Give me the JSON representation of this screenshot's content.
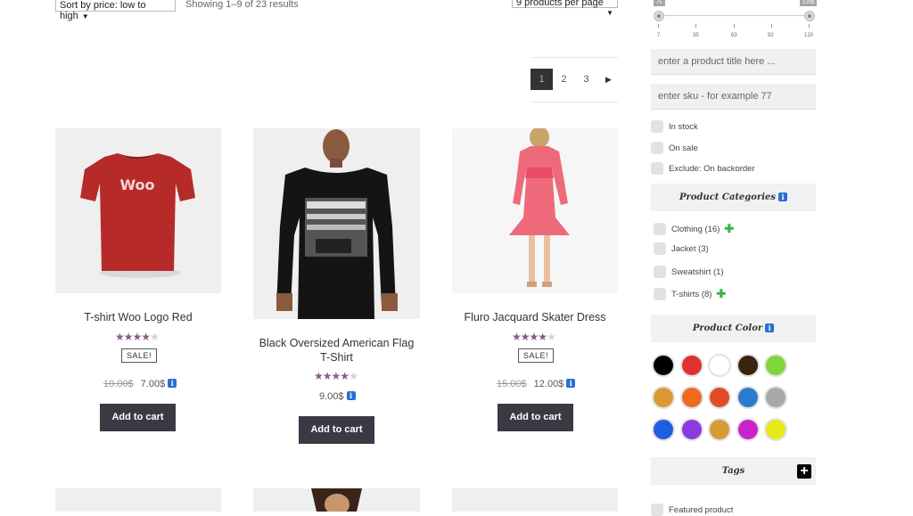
{
  "toolbar": {
    "sort_label": "Sort by price: low to high",
    "result_count": "Showing 1–9 of 23 results",
    "per_page_label": "9 products per page"
  },
  "pagination": {
    "pages": [
      "1",
      "2",
      "3"
    ],
    "current": "1",
    "next_icon": "triangle-right-icon"
  },
  "products": [
    {
      "title": "T-shirt Woo Logo Red",
      "rating": 4,
      "sale_badge": "SALE!",
      "old_price": "10.00$",
      "price": "7.00$",
      "button": "Add to cart",
      "image_text": "Woo"
    },
    {
      "title": "Black Oversized American Flag T-Shirt",
      "rating": 4,
      "price": "9.00$",
      "button": "Add to cart"
    },
    {
      "title": "Fluro Jacquard Skater Dress",
      "rating": 4,
      "sale_badge": "SALE!",
      "old_price": "15.00$",
      "price": "12.00$",
      "button": "Add to cart"
    }
  ],
  "sidebar": {
    "price_slider": {
      "min_value": "75",
      "max_value": "120$",
      "tick_labels": [
        "7",
        "35",
        "63",
        "92",
        "120"
      ]
    },
    "title_search_placeholder": "enter a product title here ...",
    "sku_search_placeholder": "enter sku - for example 77",
    "stock_filters": [
      "In stock",
      "On sale",
      "Exclude: On backorder"
    ],
    "categories_heading": "Product Categories",
    "categories": [
      {
        "label": "Clothing (16)",
        "expandable": true
      },
      {
        "label": "Jacket (3)",
        "expandable": false
      },
      {
        "label": "Sweatshirt (1)",
        "expandable": false
      },
      {
        "label": "T-shirts (8)",
        "expandable": true
      }
    ],
    "color_heading": "Product Color",
    "colors": [
      "#000000",
      "#e03030",
      "#ffffff",
      "#3a2410",
      "#7ed63a",
      "#dc9a35",
      "#ee6a1f",
      "#e04b28",
      "#2b7bd0",
      "#a8a8a8",
      "#1f5ee0",
      "#8a3be0",
      "#d89a35",
      "#cc22cc",
      "#e8e81a"
    ],
    "tags_heading": "Tags",
    "tag_items": [
      "Featured product"
    ]
  },
  "icons": {
    "info": "info-icon",
    "expand": "plus-icon"
  }
}
